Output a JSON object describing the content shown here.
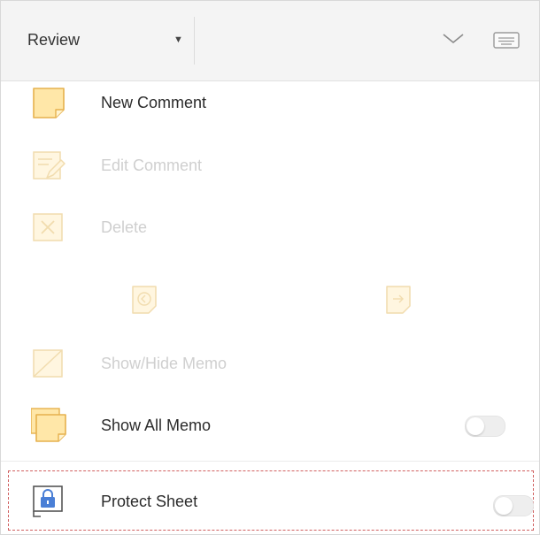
{
  "header": {
    "tab_label": "Review",
    "caret": "▼",
    "icons": [
      "chevron-down-icon",
      "keyboard-icon"
    ]
  },
  "menu": {
    "new_comment": "New Comment",
    "edit_comment": "Edit Comment",
    "delete": "Delete",
    "show_hide_memo": "Show/Hide Memo",
    "show_all_memo": "Show All Memo",
    "protect_sheet": "Protect Sheet"
  },
  "states": {
    "show_all_memo_on": false,
    "protect_sheet_on": false
  },
  "colors": {
    "note_fill": "#ffe7a8",
    "note_stroke": "#e6b14d",
    "disabled_fill": "#fff6e0",
    "disabled_stroke": "#f1dcae",
    "lock_blue": "#4a7fd6",
    "highlight_dash": "#d06060"
  }
}
